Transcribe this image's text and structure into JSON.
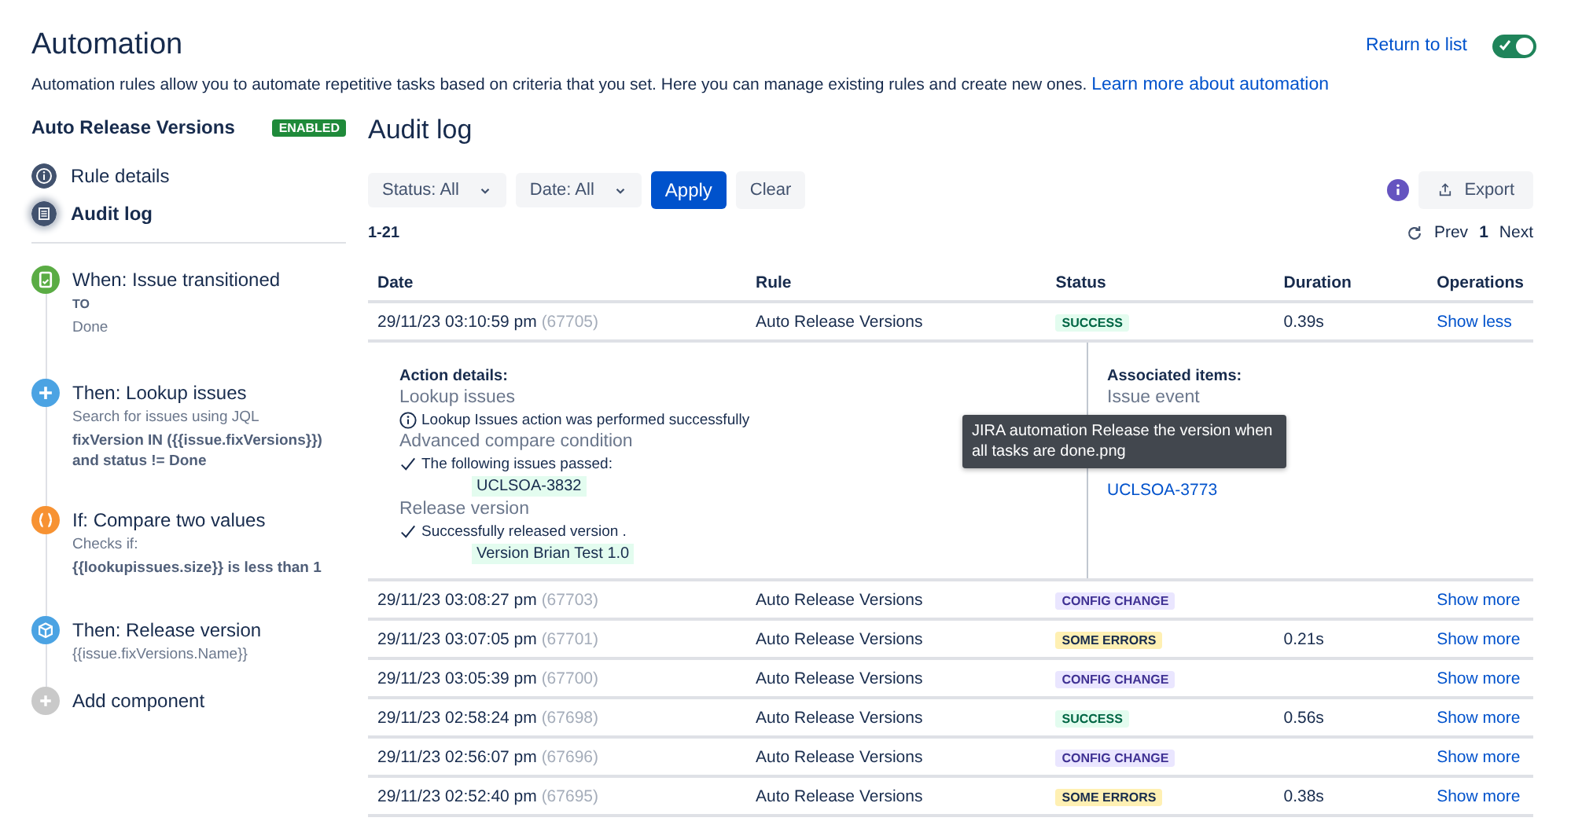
{
  "header": {
    "title": "Automation",
    "description": "Automation rules allow you to automate repetitive tasks based on criteria that you set. Here you can manage existing rules and create new ones.",
    "learn_more_link": "Learn more about automation",
    "return_link": "Return to list",
    "rule_toggle": {
      "on": true
    }
  },
  "sidebar": {
    "rule_name": "Auto Release Versions",
    "rule_badge": "ENABLED",
    "nav": [
      {
        "label": "Rule details",
        "kind": "info",
        "selected": false
      },
      {
        "label": "Audit log",
        "kind": "list",
        "selected": true
      }
    ],
    "steps": [
      {
        "kind": "trigger",
        "color": "#5aac44",
        "title": "When: Issue transitioned",
        "lines": [
          {
            "text": "TO",
            "bold": true,
            "small": true
          },
          {
            "text": "Done",
            "bold": false,
            "small": false
          }
        ]
      },
      {
        "kind": "action",
        "color": "#4ba3e3",
        "title": "Then: Lookup issues",
        "lines": [
          {
            "text": "Search for issues using JQL",
            "bold": false,
            "small": false
          },
          {
            "text": "fixVersion IN ({{issue.fixVersions}}) and status != Done",
            "bold": true,
            "small": false
          }
        ]
      },
      {
        "kind": "condition",
        "color": "#f79232",
        "title": "If: Compare two values",
        "lines": [
          {
            "text": "Checks if:",
            "bold": false,
            "small": false
          },
          {
            "text": "{{lookupissues.size}} is less than 1",
            "bold": true,
            "small": false
          }
        ]
      },
      {
        "kind": "release",
        "color": "#4ba3e3",
        "title": "Then: Release version",
        "lines": [
          {
            "text": "{{issue.fixVersions.Name}}",
            "bold": false,
            "small": false
          }
        ]
      },
      {
        "kind": "add",
        "color": "#c9c9c9",
        "title": "Add component"
      }
    ]
  },
  "audit": {
    "title": "Audit log",
    "filters": [
      {
        "label": "Status: All"
      },
      {
        "label": "Date: All"
      }
    ],
    "apply": "Apply",
    "clear": "Clear",
    "export": "Export",
    "range": "1-21",
    "pager": {
      "prev": "Prev",
      "page": "1",
      "next": "Next"
    },
    "columns": [
      "Date",
      "Rule",
      "Status",
      "Duration",
      "Operations"
    ],
    "rows": [
      {
        "date": "29/11/23 03:10:59 pm",
        "id": "(67705)",
        "rule": "Auto Release Versions",
        "status": "SUCCESS",
        "kind": "success",
        "duration": "0.39s",
        "operation": "Show less",
        "details": {
          "heading": "Action details:",
          "groups": [
            {
              "title": "Lookup issues",
              "kind": "info",
              "message": "Lookup Issues action was performed successfully"
            },
            {
              "title": "Advanced compare condition",
              "kind": "check",
              "message": "The following issues passed:",
              "chips": [
                "UCLSOA-3832"
              ]
            },
            {
              "title": "Release version",
              "kind": "check",
              "message": "Successfully released version .",
              "chips": [
                "Version Brian Test 1.0"
              ]
            }
          ],
          "associated": {
            "heading": "Associated items:",
            "label": "Issue event",
            "links": [
              "UCLSOA-3773"
            ]
          },
          "tooltip": "JIRA automation Release the version when all tasks are done.png"
        }
      },
      {
        "date": "29/11/23 03:08:27 pm",
        "id": "(67703)",
        "rule": "Auto Release Versions",
        "status": "CONFIG CHANGE",
        "kind": "config",
        "operation": "Show more"
      },
      {
        "date": "29/11/23 03:07:05 pm",
        "id": "(67701)",
        "rule": "Auto Release Versions",
        "status": "SOME ERRORS",
        "kind": "errors",
        "duration": "0.21s",
        "operation": "Show more"
      },
      {
        "date": "29/11/23 03:05:39 pm",
        "id": "(67700)",
        "rule": "Auto Release Versions",
        "status": "CONFIG CHANGE",
        "kind": "config",
        "operation": "Show more"
      },
      {
        "date": "29/11/23 02:58:24 pm",
        "id": "(67698)",
        "rule": "Auto Release Versions",
        "status": "SUCCESS",
        "kind": "success",
        "duration": "0.56s",
        "operation": "Show more"
      },
      {
        "date": "29/11/23 02:56:07 pm",
        "id": "(67696)",
        "rule": "Auto Release Versions",
        "status": "CONFIG CHANGE",
        "kind": "config",
        "operation": "Show more"
      },
      {
        "date": "29/11/23 02:52:40 pm",
        "id": "(67695)",
        "rule": "Auto Release Versions",
        "status": "SOME ERRORS",
        "kind": "errors",
        "duration": "0.38s",
        "operation": "Show more"
      }
    ]
  }
}
